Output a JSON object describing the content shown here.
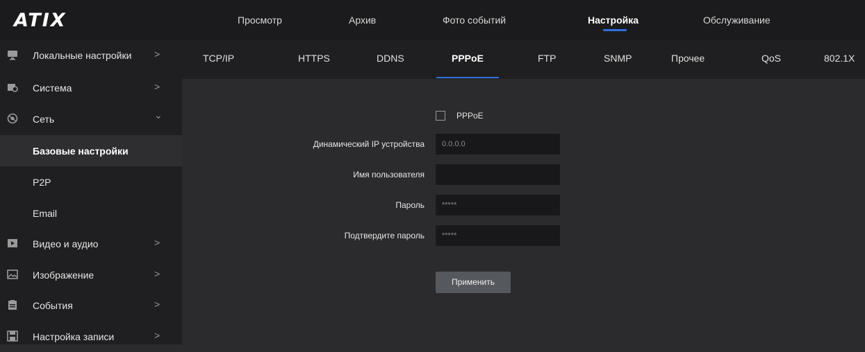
{
  "brand": {
    "logo_text": "ATIX"
  },
  "top_nav": {
    "items": [
      "Просмотр",
      "Архив",
      "Фото событий",
      "Настройка",
      "Обслуживание"
    ],
    "active": "Настройка"
  },
  "sidebar": {
    "items": [
      {
        "label": "Локальные настройки",
        "icon": "monitor-icon",
        "chevron": ">"
      },
      {
        "label": "Система",
        "icon": "system-icon",
        "chevron": ">"
      },
      {
        "label": "Сеть",
        "icon": "network-icon",
        "chevron": "⌄"
      },
      {
        "label": "Видео и аудио",
        "icon": "video-icon",
        "chevron": ">"
      },
      {
        "label": "Изображение",
        "icon": "image-icon",
        "chevron": ">"
      },
      {
        "label": "События",
        "icon": "events-icon",
        "chevron": ">"
      },
      {
        "label": "Настройка записи",
        "icon": "record-icon",
        "chevron": ">"
      }
    ],
    "subitems": [
      "Базовые настройки",
      "P2P",
      "Email"
    ],
    "active_subitem": "Базовые настройки"
  },
  "sub_nav": {
    "tabs": [
      "TCP/IP",
      "HTTPS",
      "DDNS",
      "PPPoE",
      "FTP",
      "SNMP",
      "Прочее",
      "QoS",
      "802.1X"
    ],
    "active": "PPPoE"
  },
  "form": {
    "pppoe_checkbox_label": "PPPoE",
    "pppoe_checked": false,
    "dynamic_ip_label": "Динамический IP устройства",
    "dynamic_ip_value": "0.0.0.0",
    "username_label": "Имя пользователя",
    "username_value": "",
    "password_label": "Пароль",
    "password_value": "*****",
    "confirm_label": "Подтвердите пароль",
    "confirm_value": "*****",
    "apply_label": "Применить"
  },
  "colors": {
    "accent": "#2f6fe0",
    "background": "#2b2b2d",
    "sidebar": "#1f1f21"
  }
}
